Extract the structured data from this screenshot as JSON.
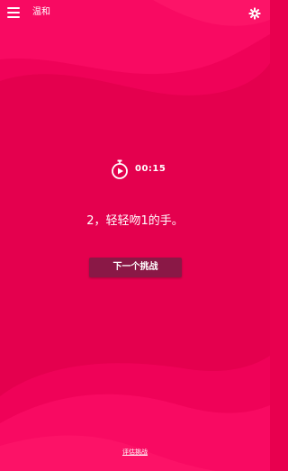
{
  "header": {
    "title": "温和",
    "menu_icon": "hamburger-menu-icon",
    "settings_icon": "settings-gear-icon"
  },
  "timer": {
    "icon": "stopwatch-icon",
    "value": "00:15"
  },
  "challenge": {
    "text": "2，轻轻吻1的手。"
  },
  "actions": {
    "next_label": "下一个挑战"
  },
  "footer": {
    "link_label": "评估挑战"
  },
  "colors": {
    "background": "#e8004f",
    "wave_light": "#f5055e",
    "wave_dark": "#d6004c",
    "button": "#8a1846",
    "text": "#ffffff"
  }
}
